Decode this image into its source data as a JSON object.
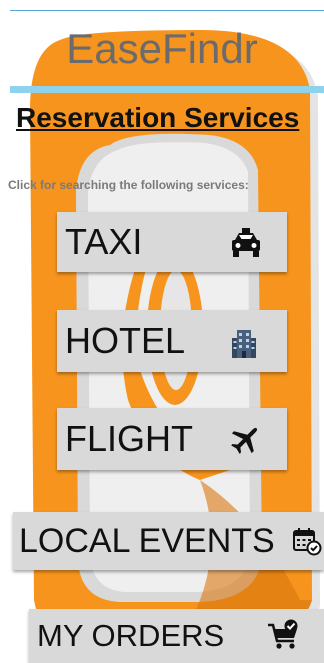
{
  "app": {
    "title": "EaseFindr"
  },
  "header": {
    "section_title": "Reservation Services",
    "instruction": "Click for searching the following services:"
  },
  "services": [
    {
      "label": "TAXI",
      "icon": "taxi-icon"
    },
    {
      "label": "HOTEL",
      "icon": "hotel-icon"
    },
    {
      "label": "FLIGHT",
      "icon": "airplane-icon"
    },
    {
      "label": "LOCAL EVENTS",
      "icon": "calendar-check-icon"
    },
    {
      "label": "MY ORDERS",
      "icon": "cart-check-icon"
    }
  ],
  "colors": {
    "logo_orange": "#F7941D",
    "logo_grey": "#D6D6D6",
    "title_rule": "#8FD2EE",
    "button_bg": "#D9D9D9"
  }
}
